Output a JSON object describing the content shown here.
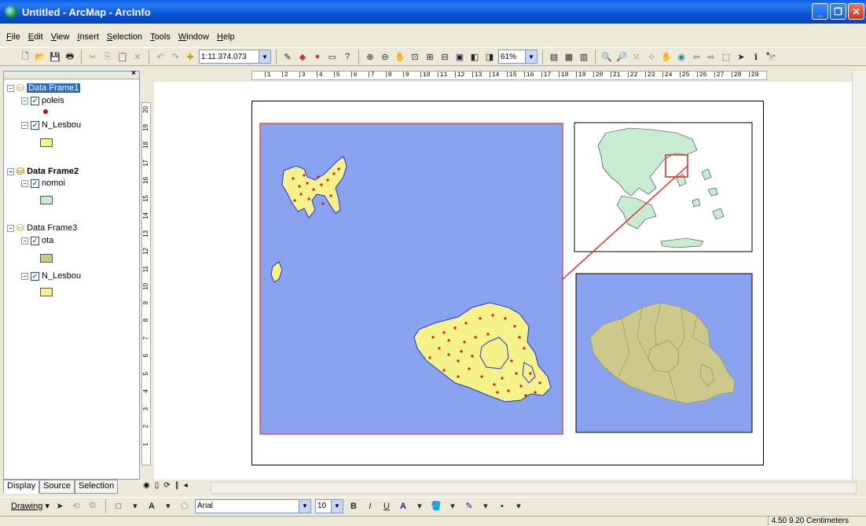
{
  "window": {
    "title": "Untitled - ArcMap - ArcInfo"
  },
  "menu": [
    "File",
    "Edit",
    "View",
    "Insert",
    "Selection",
    "Tools",
    "Window",
    "Help"
  ],
  "toolbar": {
    "scale": "1:11.374.073",
    "zoom_percent": "61%"
  },
  "toc": {
    "frames": [
      {
        "name": "Data Frame1",
        "layers": [
          {
            "name": "poleis",
            "symbol_color": "#b01616",
            "symbol": "point"
          },
          {
            "name": "N_Lesbou",
            "symbol_color": "#f5f28a",
            "symbol": "polygon"
          }
        ]
      },
      {
        "name": "Data Frame2",
        "layers": [
          {
            "name": "nomoi",
            "symbol_color": "#c8ecd0",
            "symbol": "polygon"
          }
        ]
      },
      {
        "name": "Data Frame3",
        "layers": [
          {
            "name": "ota",
            "symbol_color": "#cdc98a",
            "symbol": "polygon"
          },
          {
            "name": "N_Lesbou",
            "symbol_color": "#f5f28a",
            "symbol": "polygon"
          }
        ]
      }
    ],
    "tabs": [
      "Display",
      "Source",
      "Selection"
    ]
  },
  "ruler": {
    "h_ticks": [
      "1",
      "2",
      "3",
      "4",
      "5",
      "6",
      "7",
      "8",
      "9",
      "10",
      "11",
      "12",
      "13",
      "14",
      "15",
      "16",
      "17",
      "18",
      "19",
      "20",
      "21",
      "22",
      "23",
      "24",
      "25",
      "26",
      "27",
      "28",
      "29"
    ],
    "v_ticks": [
      "20",
      "19",
      "18",
      "17",
      "16",
      "15",
      "14",
      "13",
      "12",
      "11",
      "10",
      "9",
      "8",
      "7",
      "6",
      "5",
      "4",
      "3",
      "2",
      "1"
    ]
  },
  "map": {
    "water_color": "#8aa3f0",
    "land_color": "#f5f28a",
    "greece_color": "#c8ecd0",
    "ota_color": "#cdc98a",
    "frame1_border": "#e53030",
    "leader_line": "#e53030"
  },
  "drawing": {
    "menu_label": "Drawing",
    "font_name": "Arial",
    "font_size": "10"
  },
  "status": {
    "coords": "4.50  9.20 Centimeters"
  }
}
